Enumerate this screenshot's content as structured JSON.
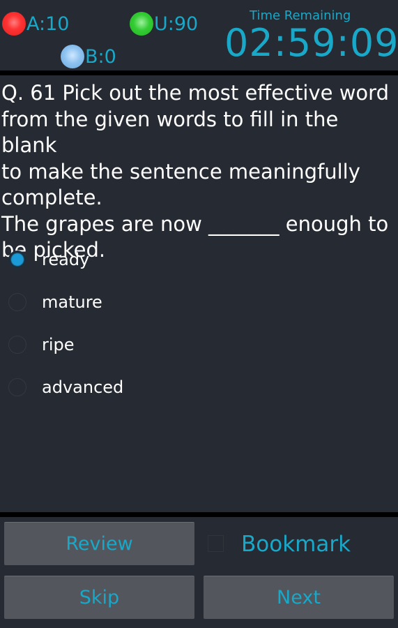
{
  "header": {
    "stats": {
      "answered": {
        "label": "A:10",
        "color": "#ee3333"
      },
      "unanswered": {
        "label": "U:90",
        "color": "#33cc33"
      },
      "bookmarked": {
        "label": "B:0",
        "color": "#8ec3f0"
      }
    },
    "time_label": "Time Remaining",
    "time_value": "02:59:09"
  },
  "question": {
    "number_label": "Q. 61",
    "lines": [
      "Q. 61  Pick out the most effective word",
      "from the given words to fill in the blank",
      "to make the sentence meaningfully",
      "complete.",
      "The grapes are now _______ enough to",
      "be picked."
    ]
  },
  "options": [
    {
      "label": "ready",
      "selected": true
    },
    {
      "label": "mature",
      "selected": false
    },
    {
      "label": "ripe",
      "selected": false
    },
    {
      "label": "advanced",
      "selected": false
    }
  ],
  "footer": {
    "review_label": "Review",
    "bookmark_label": "Bookmark",
    "bookmark_checked": false,
    "skip_label": "Skip",
    "next_label": "Next"
  },
  "colors": {
    "accent": "#19a8c8",
    "background": "#262a33",
    "button": "#53565c"
  }
}
